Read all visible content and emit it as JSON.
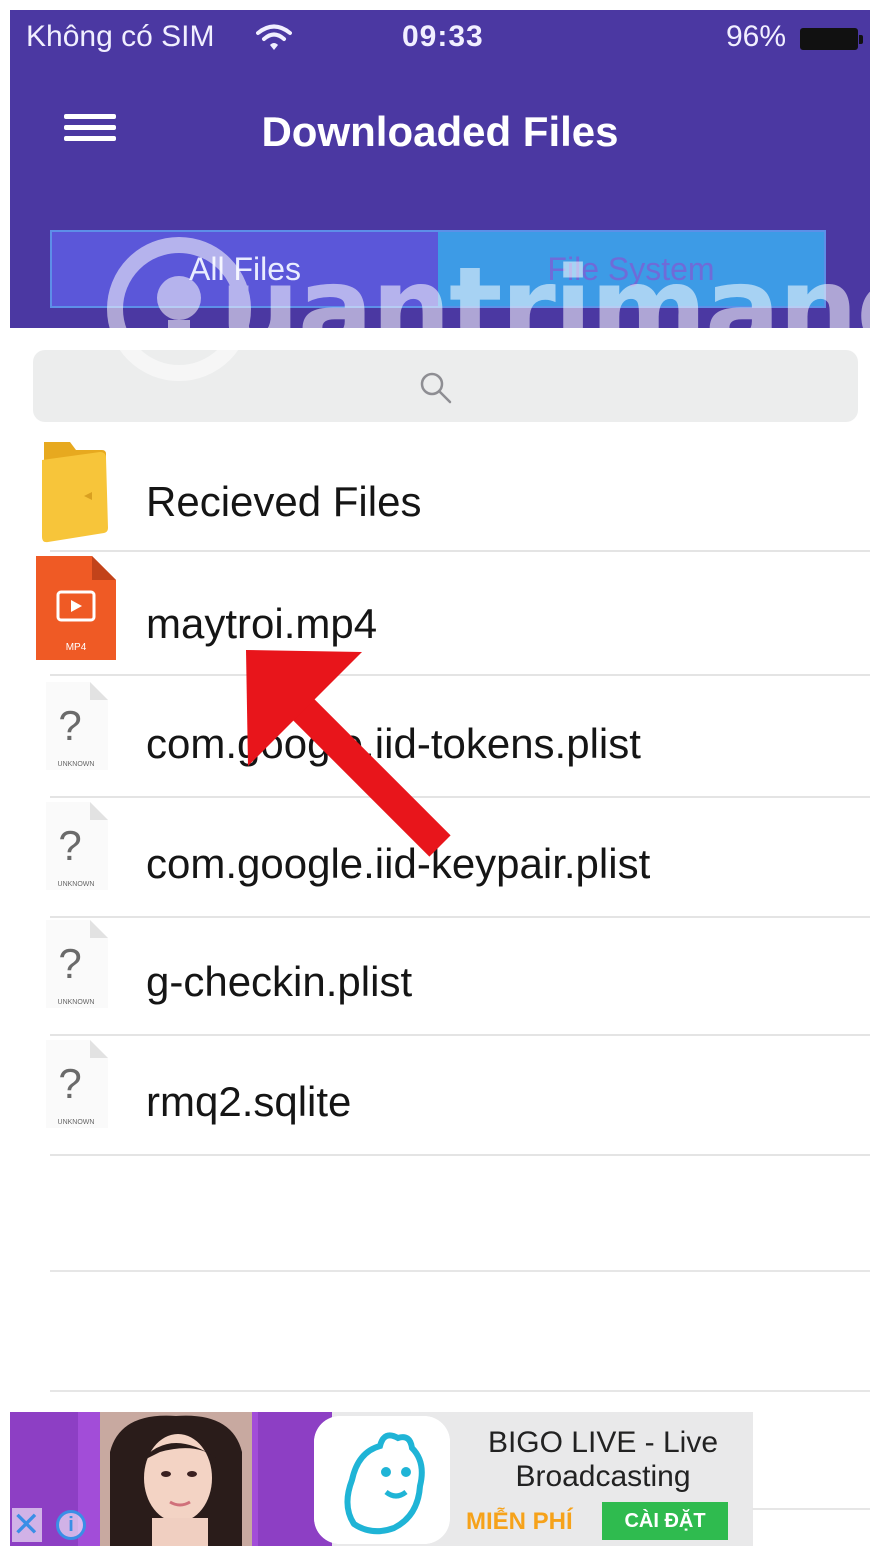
{
  "status_bar": {
    "carrier": "Không có SIM",
    "time": "09:33",
    "battery": "96%",
    "wifi_icon": "wifi-icon",
    "battery_icon": "battery-icon"
  },
  "header": {
    "title": "Downloaded Files",
    "menu_icon": "hamburger-menu-icon",
    "tabs": [
      {
        "label": "All Files",
        "selected": true
      },
      {
        "label": "File System",
        "selected": false
      }
    ]
  },
  "watermark": "uantrimang",
  "search": {
    "placeholder": "",
    "icon": "search-icon"
  },
  "files": [
    {
      "name": "Recieved Files",
      "icon": "folder-icon"
    },
    {
      "name": "maytroi.mp4",
      "icon": "video-file-icon",
      "icon_label": "MP4"
    },
    {
      "name": "com.google.iid-tokens.plist",
      "icon": "unknown-file-icon",
      "icon_label": "UNKNOWN"
    },
    {
      "name": "com.google.iid-keypair.plist",
      "icon": "unknown-file-icon",
      "icon_label": "UNKNOWN"
    },
    {
      "name": "g-checkin.plist",
      "icon": "unknown-file-icon",
      "icon_label": "UNKNOWN"
    },
    {
      "name": "rmq2.sqlite",
      "icon": "unknown-file-icon",
      "icon_label": "UNKNOWN"
    }
  ],
  "ad": {
    "title_line1": "BIGO LIVE - Live",
    "title_line2": "Broadcasting",
    "free_label": "MIỄN PHÍ",
    "install_label": "CÀI ĐẶT",
    "close_glyph": "✕",
    "info_glyph": "i"
  },
  "colors": {
    "header_bg": "#4b38a2",
    "tab_selected": "#5b57d9",
    "tab_unselected": "#3d9be6",
    "arrow": "#e8151b",
    "video_icon": "#ef5a25",
    "folder": "#f5c431"
  }
}
